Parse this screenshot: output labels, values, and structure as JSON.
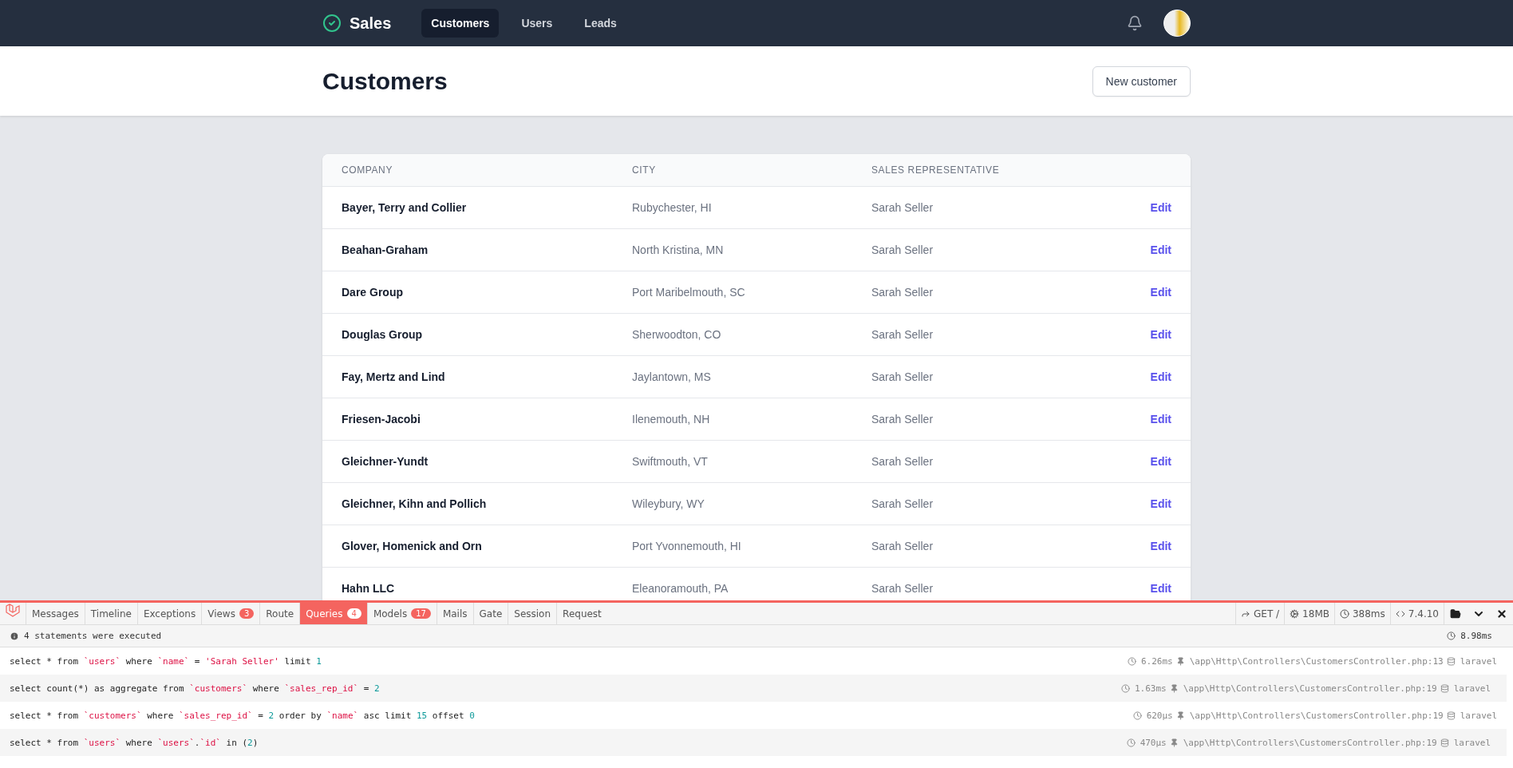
{
  "nav": {
    "brand": "Sales",
    "items": [
      {
        "label": "Customers",
        "selected": true
      },
      {
        "label": "Users",
        "selected": false
      },
      {
        "label": "Leads",
        "selected": false
      }
    ]
  },
  "header": {
    "title": "Customers",
    "button": "New customer"
  },
  "table": {
    "columns": [
      "COMPANY",
      "CITY",
      "SALES REPRESENTATIVE"
    ],
    "rows": [
      {
        "company": "Bayer, Terry and Collier",
        "city": "Rubychester, HI",
        "rep": "Sarah Seller",
        "action": "Edit"
      },
      {
        "company": "Beahan-Graham",
        "city": "North Kristina, MN",
        "rep": "Sarah Seller",
        "action": "Edit"
      },
      {
        "company": "Dare Group",
        "city": "Port Maribelmouth, SC",
        "rep": "Sarah Seller",
        "action": "Edit"
      },
      {
        "company": "Douglas Group",
        "city": "Sherwoodton, CO",
        "rep": "Sarah Seller",
        "action": "Edit"
      },
      {
        "company": "Fay, Mertz and Lind",
        "city": "Jaylantown, MS",
        "rep": "Sarah Seller",
        "action": "Edit"
      },
      {
        "company": "Friesen-Jacobi",
        "city": "Ilenemouth, NH",
        "rep": "Sarah Seller",
        "action": "Edit"
      },
      {
        "company": "Gleichner-Yundt",
        "city": "Swiftmouth, VT",
        "rep": "Sarah Seller",
        "action": "Edit"
      },
      {
        "company": "Gleichner, Kihn and Pollich",
        "city": "Wileybury, WY",
        "rep": "Sarah Seller",
        "action": "Edit"
      },
      {
        "company": "Glover, Homenick and Orn",
        "city": "Port Yvonnemouth, HI",
        "rep": "Sarah Seller",
        "action": "Edit"
      },
      {
        "company": "Hahn LLC",
        "city": "Eleanoramouth, PA",
        "rep": "Sarah Seller",
        "action": "Edit"
      }
    ]
  },
  "debugbar": {
    "tabs": [
      {
        "label": "Messages",
        "selected": false
      },
      {
        "label": "Timeline",
        "selected": false
      },
      {
        "label": "Exceptions",
        "selected": false
      },
      {
        "label": "Views",
        "badge": "3",
        "selected": false
      },
      {
        "label": "Route",
        "selected": false
      },
      {
        "label": "Queries",
        "badge": "4",
        "selected": true
      },
      {
        "label": "Models",
        "badge": "17",
        "selected": false
      },
      {
        "label": "Mails",
        "selected": false
      },
      {
        "label": "Gate",
        "selected": false
      },
      {
        "label": "Session",
        "selected": false
      },
      {
        "label": "Request",
        "selected": false
      }
    ],
    "indicators": [
      {
        "kind": "request",
        "text": "GET /"
      },
      {
        "kind": "memory",
        "text": "18MB"
      },
      {
        "kind": "time",
        "text": "388ms"
      },
      {
        "kind": "php",
        "text": "7.4.10"
      }
    ],
    "status": "4 statements were executed",
    "total_time": "8.98ms",
    "queries": [
      {
        "tokens": [
          {
            "kind": "text",
            "text": "select * from "
          },
          {
            "kind": "ident",
            "text": "`users`"
          },
          {
            "kind": "text",
            "text": " where "
          },
          {
            "kind": "ident",
            "text": "`name`"
          },
          {
            "kind": "text",
            "text": " = "
          },
          {
            "kind": "string",
            "text": "'Sarah Seller'"
          },
          {
            "kind": "text",
            "text": " limit "
          },
          {
            "kind": "number",
            "text": "1"
          }
        ],
        "time": "6.26ms",
        "source": "\\app\\Http\\Controllers\\CustomersController.php:13",
        "connection": "laravel"
      },
      {
        "tokens": [
          {
            "kind": "text",
            "text": "select count(*) as aggregate from "
          },
          {
            "kind": "ident",
            "text": "`customers`"
          },
          {
            "kind": "text",
            "text": " where "
          },
          {
            "kind": "ident",
            "text": "`sales_rep_id`"
          },
          {
            "kind": "text",
            "text": " = "
          },
          {
            "kind": "number",
            "text": "2"
          }
        ],
        "time": "1.63ms",
        "source": "\\app\\Http\\Controllers\\CustomersController.php:19",
        "connection": "laravel"
      },
      {
        "tokens": [
          {
            "kind": "text",
            "text": "select * from "
          },
          {
            "kind": "ident",
            "text": "`customers`"
          },
          {
            "kind": "text",
            "text": " where "
          },
          {
            "kind": "ident",
            "text": "`sales_rep_id`"
          },
          {
            "kind": "text",
            "text": " = "
          },
          {
            "kind": "number",
            "text": "2"
          },
          {
            "kind": "text",
            "text": " order by "
          },
          {
            "kind": "ident",
            "text": "`name`"
          },
          {
            "kind": "text",
            "text": " asc limit "
          },
          {
            "kind": "number",
            "text": "15"
          },
          {
            "kind": "text",
            "text": " offset "
          },
          {
            "kind": "number",
            "text": "0"
          }
        ],
        "time": "620μs",
        "source": "\\app\\Http\\Controllers\\CustomersController.php:19",
        "connection": "laravel"
      },
      {
        "tokens": [
          {
            "kind": "text",
            "text": "select * from "
          },
          {
            "kind": "ident",
            "text": "`users`"
          },
          {
            "kind": "text",
            "text": " where "
          },
          {
            "kind": "ident",
            "text": "`users`"
          },
          {
            "kind": "text",
            "text": "."
          },
          {
            "kind": "ident",
            "text": "`id`"
          },
          {
            "kind": "text",
            "text": " in ("
          },
          {
            "kind": "number",
            "text": "2"
          },
          {
            "kind": "text",
            "text": ")"
          }
        ],
        "time": "470μs",
        "source": "\\app\\Http\\Controllers\\CustomersController.php:19",
        "connection": "laravel"
      }
    ]
  }
}
